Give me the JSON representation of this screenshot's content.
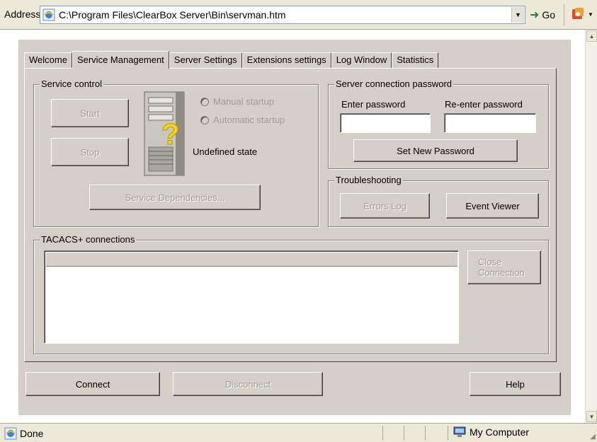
{
  "address_bar": {
    "label": "Address",
    "url": "C:\\Program Files\\ClearBox Server\\Bin\\servman.htm",
    "go_label": "Go"
  },
  "tabs": [
    "Welcome",
    "Service Management",
    "Server Settings",
    "Extensions settings",
    "Log Window",
    "Statistics"
  ],
  "active_tab": "Service Management",
  "service_control": {
    "legend": "Service control",
    "start_label": "Start",
    "stop_label": "Stop",
    "manual_startup": "Manual startup",
    "automatic_startup": "Automatic startup",
    "state_text": "Undefined state",
    "dependencies_label": "Service Dependencies..."
  },
  "password": {
    "legend": "Server connection password",
    "enter_label": "Enter password",
    "reenter_label": "Re-enter password",
    "enter_value": "",
    "reenter_value": "",
    "set_button": "Set New Password"
  },
  "troubleshooting": {
    "legend": "Troubleshooting",
    "errors_log": "Errors Log",
    "event_viewer": "Event Viewer"
  },
  "tacacs": {
    "legend": "TACACS+ connections",
    "close_connection": "Close Connection"
  },
  "bottom_buttons": {
    "connect": "Connect",
    "disconnect": "Disconnect",
    "help": "Help"
  },
  "status_bar": {
    "status": "Done",
    "zone": "My Computer"
  },
  "icons": {
    "page": "ie-page-icon",
    "go": "go-arrow-icon",
    "toolbar": "research-icon",
    "server": "server-tower-icon",
    "question": "question-mark-icon",
    "computer": "my-computer-icon"
  }
}
